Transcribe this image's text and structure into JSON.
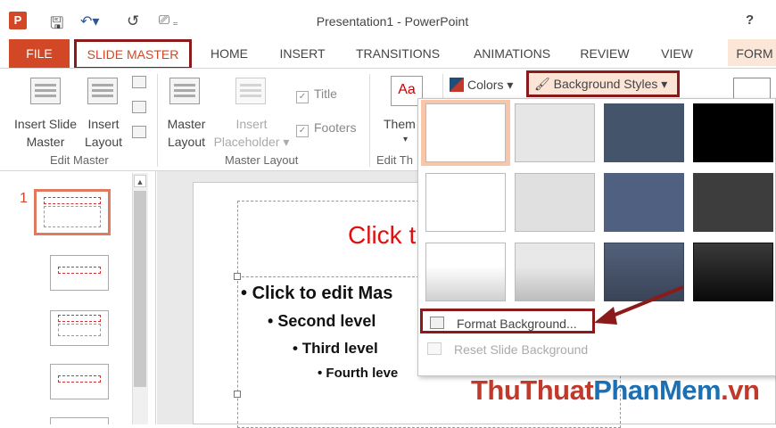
{
  "window": {
    "title": "Presentation1 - PowerPoint",
    "help": "?"
  },
  "tabs": [
    "FILE",
    "SLIDE MASTER",
    "HOME",
    "INSERT",
    "TRANSITIONS",
    "ANIMATIONS",
    "REVIEW",
    "VIEW",
    "FORM"
  ],
  "ribbon": {
    "insert_slide_master": [
      "Insert Slide",
      "Master"
    ],
    "insert_layout": [
      "Insert",
      "Layout"
    ],
    "edit_master_group": "Edit Master",
    "master_layout_btn": [
      "Master",
      "Layout"
    ],
    "insert_placeholder": [
      "Insert",
      "Placeholder"
    ],
    "title_check": "Title",
    "footers_check": "Footers",
    "master_layout_group": "Master Layout",
    "themes_btn": "Them",
    "edit_theme_group": "Edit Th",
    "colors_btn": "Colors",
    "background_styles_btn": "Background Styles"
  },
  "thumbnails": {
    "selected_number": "1"
  },
  "slide": {
    "title_placeholder": "Click t",
    "levels": [
      "Click to edit Mas",
      "Second level",
      "Third level",
      "Fourth leve"
    ]
  },
  "gallery": {
    "colors": [
      [
        "#ffffff",
        "#e6e6e6",
        "#44546a",
        "#000000"
      ],
      [
        "#ffffff",
        "#e0e0e0",
        "#4f6080",
        "#3d3d3d"
      ],
      [
        "gradient-white",
        "gradient-gray",
        "gradient-slate",
        "gradient-black"
      ]
    ],
    "format_background": "Format Background...",
    "reset_slide_background": "Reset Slide Background"
  },
  "watermark": {
    "part1": "ThuThuat",
    "part2": "PhanMem",
    "part3": ".vn"
  },
  "accent": "#d24726",
  "highlight_border": "#8b1a1a"
}
